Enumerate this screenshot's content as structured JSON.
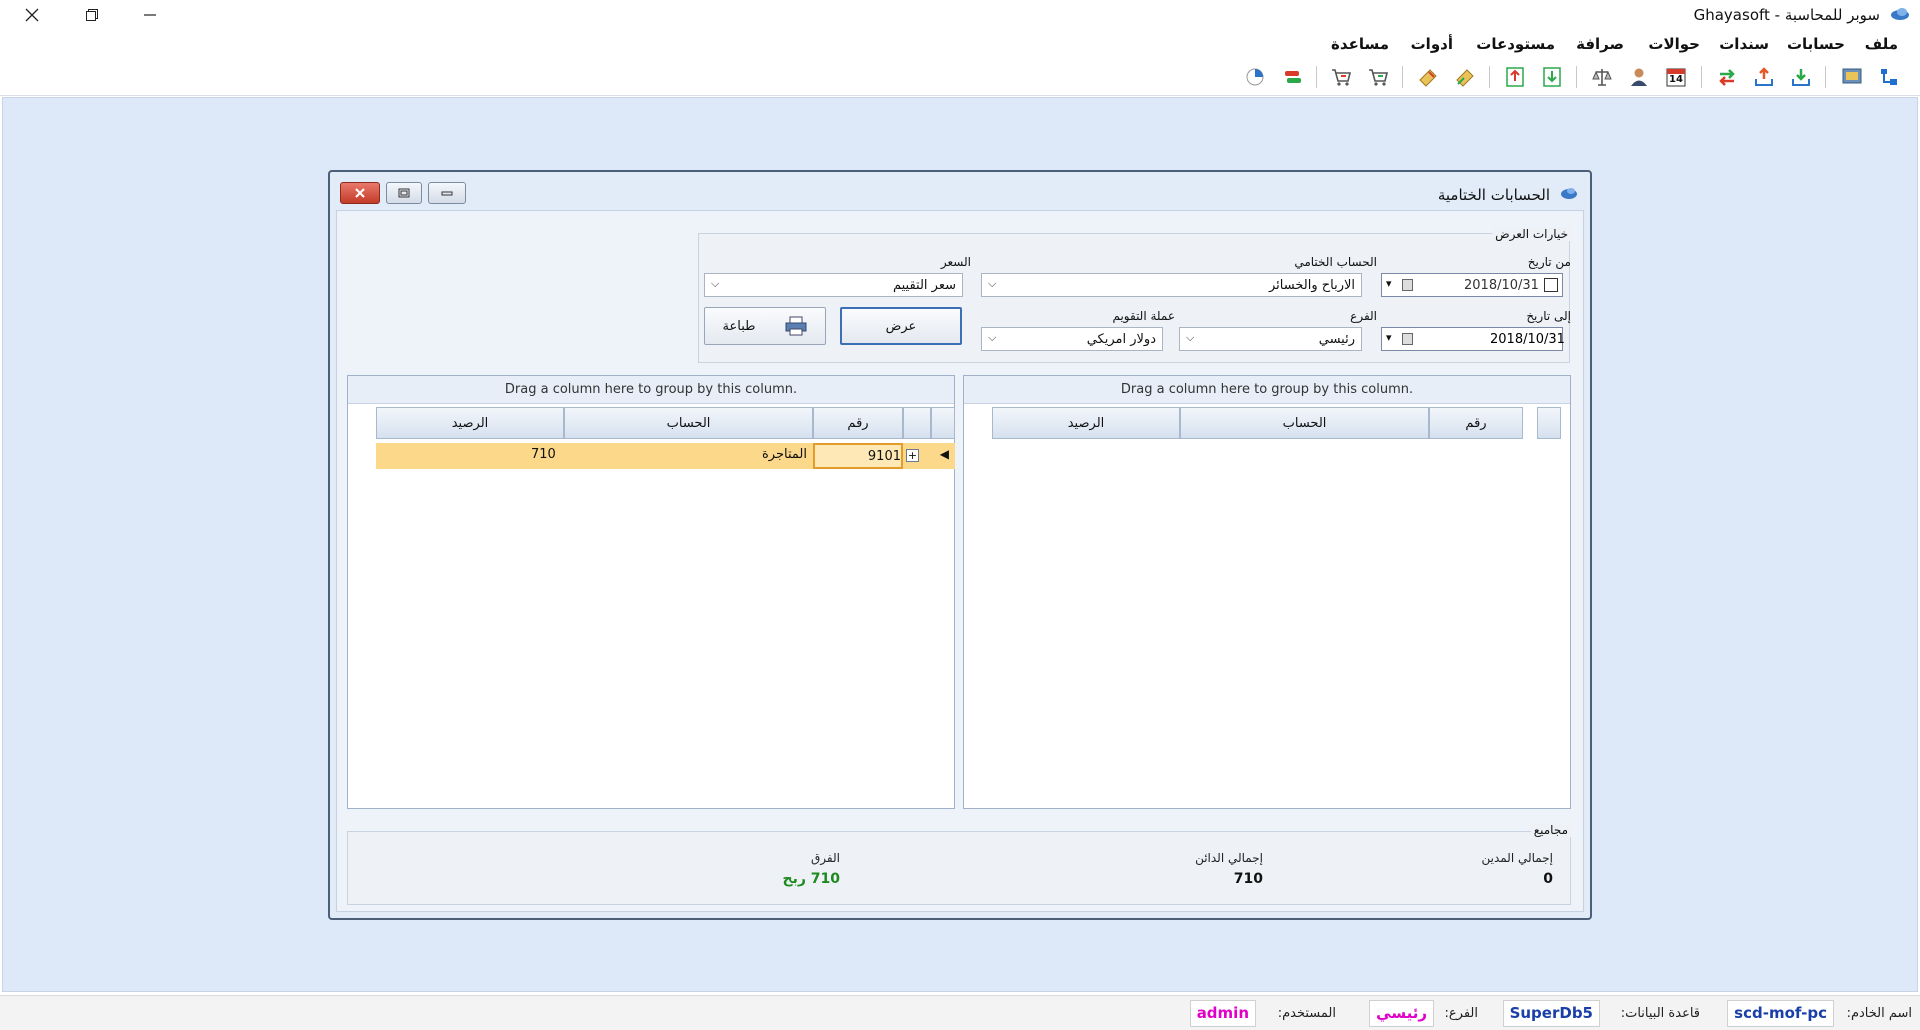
{
  "window": {
    "title": "سوبر للمحاسبة - Ghayasoft"
  },
  "menu": [
    "ملف",
    "حسابات",
    "سندات",
    "حوالات",
    "صرافة",
    "مستودعات",
    "أدوات",
    "مساعدة"
  ],
  "toolbar": {
    "calendar_day": "14"
  },
  "dialog": {
    "title": "الحسابات الختامية",
    "options": {
      "legend": "خيارات العرض",
      "from_date_label": "من تاريخ",
      "from_date_value": "2018/10/31",
      "to_date_label": "إلى تاريخ",
      "to_date_value": "2018/10/31",
      "final_account_label": "الحساب الختامي",
      "final_account_value": "الارباح والخسائر",
      "price_label": "السعر",
      "price_value": "سعر التقييم",
      "branch_label": "الفرع",
      "branch_value": "رئيسي",
      "currency_label": "عملة التقويم",
      "currency_value": "دولار امريكي",
      "show_button": "عرض",
      "print_button": "طباعة"
    },
    "grid_right": {
      "group_hint": "Drag a column here to group by this column.",
      "columns": [
        "رقم",
        "الحساب",
        "الرصيد"
      ],
      "rows": []
    },
    "grid_left": {
      "group_hint": "Drag a column here to group by this column.",
      "columns": [
        "رقم",
        "الحساب",
        "الرصيد"
      ],
      "rows": [
        {
          "number": "9101",
          "account": "المتاجرة",
          "balance": "710"
        }
      ]
    },
    "totals": {
      "legend": "مجاميع",
      "debit_label": "إجمالي المدين",
      "debit_value": "0",
      "credit_label": "إجمالي الدائن",
      "credit_value": "710",
      "diff_label": "الفرق",
      "diff_value": "710 ربح"
    }
  },
  "status": {
    "server_label": "اسم الخادم:",
    "server_value": "scd-mof-pc",
    "db_label": "قاعدة البيانات:",
    "db_value": "SuperDb5",
    "branch_label": "الفرع:",
    "branch_value": "رئيسي",
    "user_label": "المستخدم:",
    "user_value": "admin"
  },
  "colors": {
    "workspace": "#dde9f8",
    "selected_row": "#fcd88a",
    "profit_green": "#1d8a1d",
    "status_blue": "#1a3fa8",
    "status_magenta": "#e000c8"
  }
}
